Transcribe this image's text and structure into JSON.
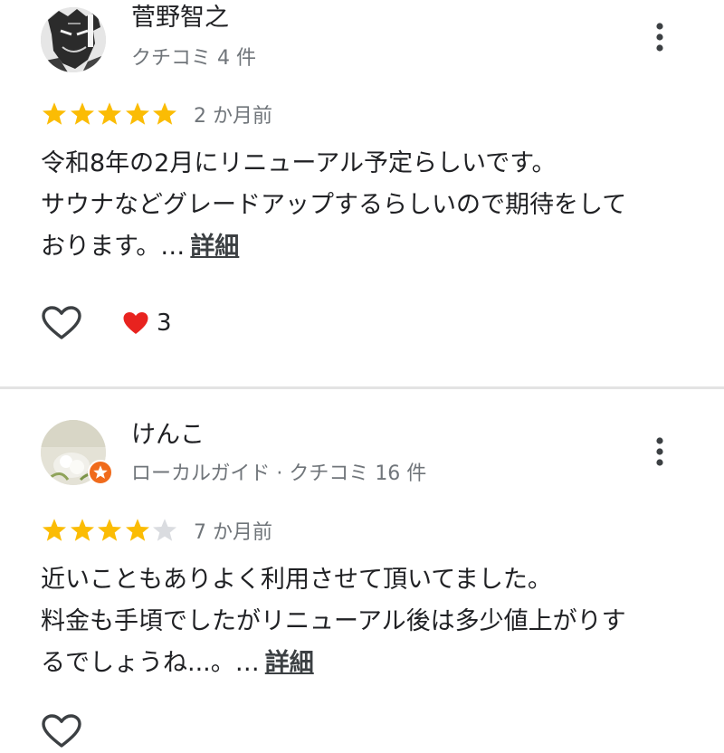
{
  "reviews": [
    {
      "author": "菅野智之",
      "meta": "クチコミ 4 件",
      "rating": 5,
      "max_rating": 5,
      "date": "2 か月前",
      "text_lines": [
        "令和8年の2月にリニューアル予定らしいです。",
        "サウナなどグレードアップするらしいので期待をして",
        "おります。…"
      ],
      "details_label": "詳細",
      "reaction_count": "3"
    },
    {
      "author": "けんこ",
      "meta": "ローカルガイド · クチコミ 16 件",
      "rating": 4,
      "max_rating": 5,
      "date": "7 か月前",
      "text_lines": [
        "近いこともありよく利用させて頂いてました。",
        "料金も手頃でしたがリニューアル後は多少値上がりす",
        "るでしょうね...。…"
      ],
      "details_label": "詳細"
    }
  ],
  "colors": {
    "star_filled": "#fbbc04",
    "star_empty": "#dadce0",
    "heart": "#e8231f",
    "guide_badge": "#f06b1c",
    "divider": "#e3e3e3"
  },
  "icons": {
    "like": "heart-outline-icon",
    "reaction": "heart-filled-icon",
    "more": "more-vert-icon",
    "badge": "local-guide-badge-icon"
  }
}
